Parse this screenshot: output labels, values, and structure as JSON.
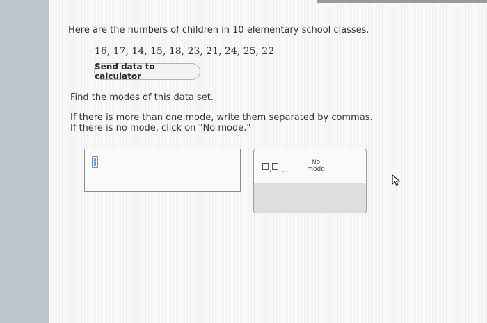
{
  "question": {
    "intro": "Here are the numbers of children in 10 elementary school classes.",
    "data_values": "16, 17, 14, 15, 18, 23, 21, 24, 25, 22",
    "calculator_button": "Send data to calculator",
    "instruction": "Find the modes of this data set.",
    "hint_line1": "If there is more than one mode, write them separated by commas.",
    "hint_line2": "If there is no mode, click on \"No mode.\""
  },
  "answer": {
    "value": ""
  },
  "palette": {
    "multi_comma": ",",
    "multi_dots": "...",
    "no_mode_line1": "No",
    "no_mode_line2": "mode",
    "clear_symbol": "×",
    "reset_symbol": "↻"
  },
  "colors": {
    "left_strip": "#bcc6ca",
    "text": "#333333",
    "cursor_accent": "#7d9cd6"
  }
}
